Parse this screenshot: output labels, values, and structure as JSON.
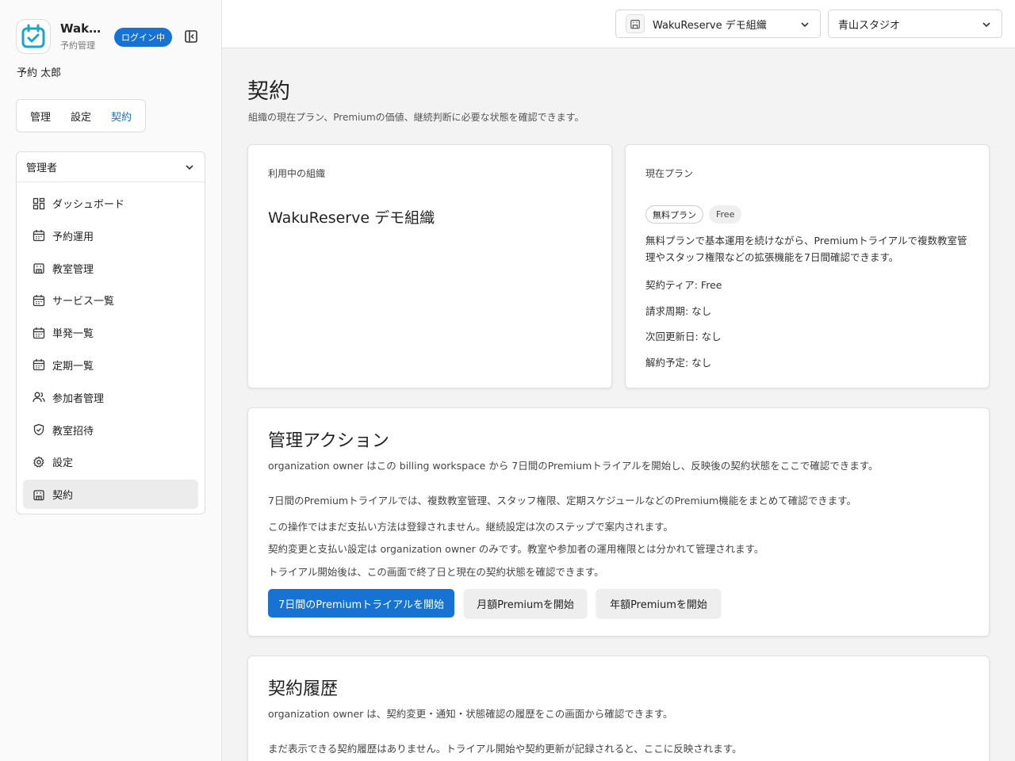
{
  "brand": {
    "name": "WakuReserve",
    "subtitle": "予約管理"
  },
  "sidebar": {
    "login_status": "ログイン中",
    "user_name": "予約 太郎",
    "tabs": [
      {
        "label": "管理",
        "active": false
      },
      {
        "label": "設定",
        "active": false
      },
      {
        "label": "契約",
        "active": true
      }
    ],
    "role_selector": "管理者",
    "menu": [
      {
        "label": "ダッシュボード",
        "icon": "dashboard-icon"
      },
      {
        "label": "予約運用",
        "icon": "calendar-icon"
      },
      {
        "label": "教室管理",
        "icon": "building-icon"
      },
      {
        "label": "サービス一覧",
        "icon": "calendar-icon"
      },
      {
        "label": "単発一覧",
        "icon": "calendar-icon"
      },
      {
        "label": "定期一覧",
        "icon": "calendar-icon"
      },
      {
        "label": "参加者管理",
        "icon": "users-icon"
      },
      {
        "label": "教室招待",
        "icon": "shield-icon"
      },
      {
        "label": "設定",
        "icon": "gear-icon"
      },
      {
        "label": "契約",
        "icon": "building-icon",
        "active": true
      }
    ]
  },
  "topbar": {
    "organization": "WakuReserve デモ組織",
    "studio": "青山スタジオ"
  },
  "page": {
    "title": "契約",
    "description": "組織の現在プラン、Premiumの価値、継続判断に必要な状態を確認できます。"
  },
  "org_card": {
    "label": "利用中の組織",
    "name": "WakuReserve デモ組織"
  },
  "plan_card": {
    "label": "現在プラン",
    "badge_plan": "無料プラン",
    "badge_tier": "Free",
    "description": "無料プランで基本運用を続けながら、Premiumトライアルで複数教室管理やスタッフ権限などの拡張機能を7日間確認できます。",
    "tier": "契約ティア: Free",
    "billing_cycle": "請求周期: なし",
    "next_renewal": "次回更新日: なし",
    "cancellation": "解約予定: なし"
  },
  "actions_card": {
    "title": "管理アクション",
    "description": "organization owner はこの billing workspace から 7日間のPremiumトライアルを開始し、反映後の契約状態をここで確認できます。",
    "lines": [
      "7日間のPremiumトライアルでは、複数教室管理、スタッフ権限、定期スケジュールなどのPremium機能をまとめて確認できます。",
      "この操作ではまだ支払い方法は登録されません。継続設定は次のステップで案内されます。",
      "契約変更と支払い設定は organization owner のみです。教室や参加者の運用権限とは分かれて管理されます。",
      "トライアル開始後は、この画面で終了日と現在の契約状態を確認できます。"
    ],
    "btn_trial": "7日間のPremiumトライアルを開始",
    "btn_monthly": "月額Premiumを開始",
    "btn_yearly": "年額Premiumを開始"
  },
  "history_card": {
    "title": "契約履歴",
    "description": "organization owner は、契約変更・通知・状態確認の履歴をこの画面から確認できます。",
    "empty": "まだ表示できる契約履歴はありません。トライアル開始や契約更新が記録されると、ここに反映されます。"
  },
  "colors": {
    "accent": "#1673d4",
    "logo": "#1aa6c8"
  }
}
